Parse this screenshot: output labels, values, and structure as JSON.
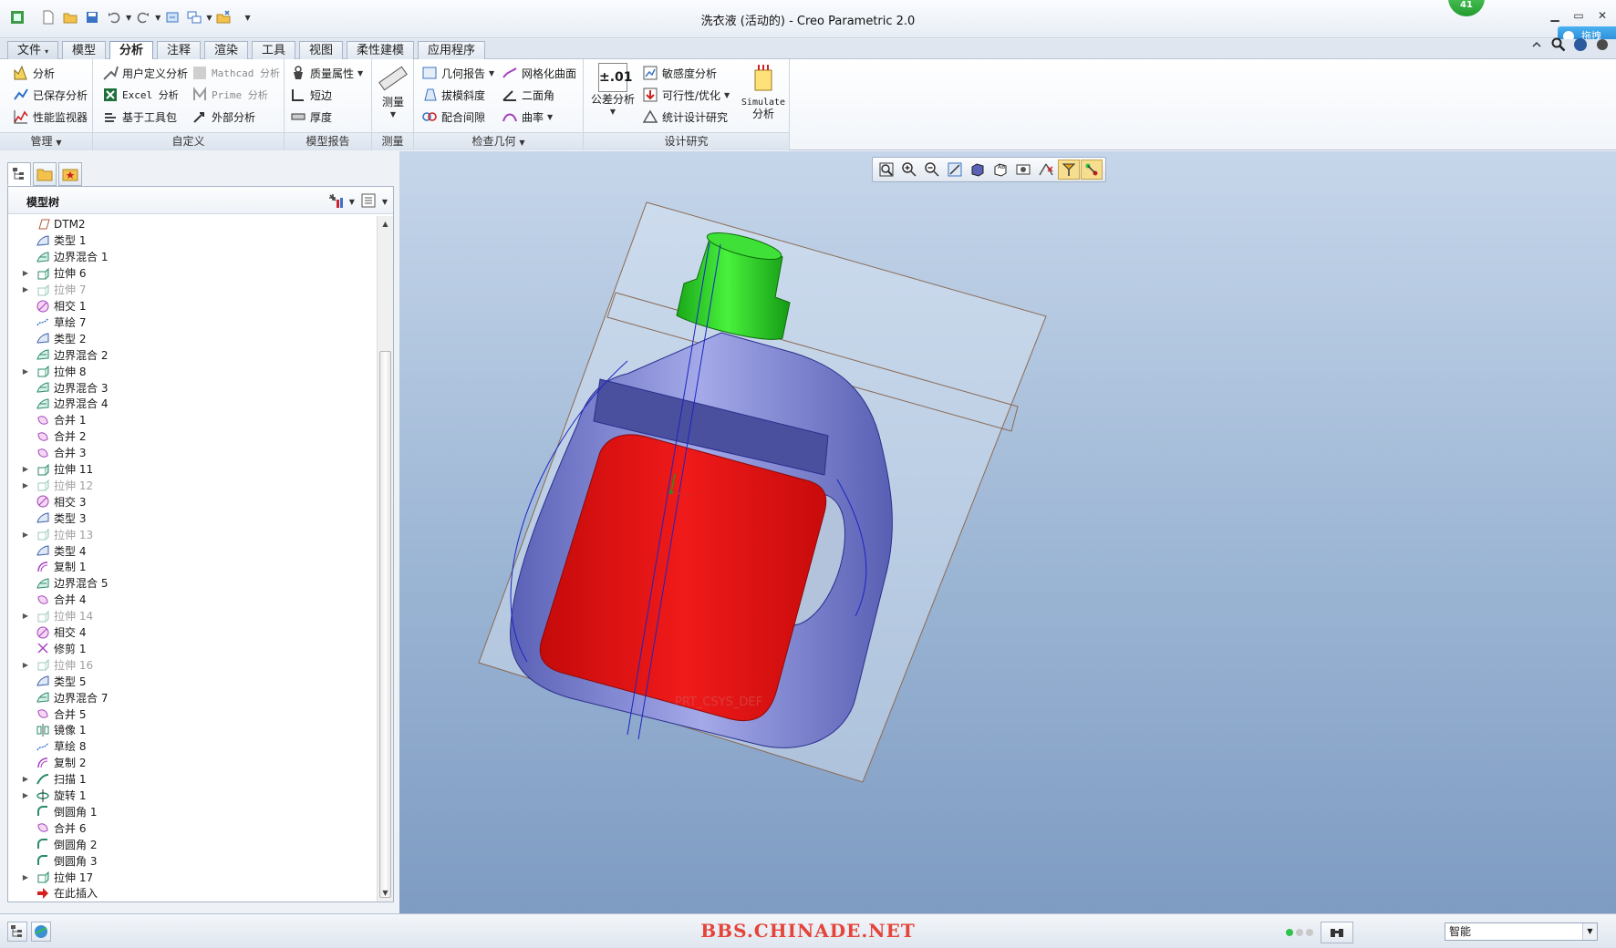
{
  "window": {
    "title": "洗衣液 (活动的) - Creo Parametric 2.0",
    "badge": "41",
    "yunpan_label": "拖拽"
  },
  "tabs": [
    {
      "label": "文件",
      "dropdown": "▾"
    },
    {
      "label": "模型"
    },
    {
      "label": "分析"
    },
    {
      "label": "注释"
    },
    {
      "label": "渲染"
    },
    {
      "label": "工具"
    },
    {
      "label": "视图"
    },
    {
      "label": "柔性建模"
    },
    {
      "label": "应用程序"
    }
  ],
  "ribbon": {
    "manage": {
      "label": "管理",
      "items": [
        "分析",
        "已保存分析",
        "性能监视器"
      ]
    },
    "custom": {
      "label": "自定义",
      "items": [
        "用户定义分析",
        "Excel 分析",
        "基于工具包",
        "Mathcad 分析",
        "Prime 分析",
        "外部分析"
      ]
    },
    "model_report": {
      "label": "模型报告",
      "items": [
        "质量属性",
        "短边",
        "厚度"
      ]
    },
    "measure": {
      "label": "测量",
      "button": "测量"
    },
    "inspect": {
      "label": "检查几何",
      "items": [
        "几何报告",
        "拔模斜度",
        "配合间隙",
        "网格化曲面",
        "二面角",
        "曲率"
      ]
    },
    "design": {
      "label": "设计研究",
      "tolerance": "公差分析",
      "tolerance_icon": "±.01",
      "items": [
        "敏感度分析",
        "可行性/优化",
        "统计设计研究"
      ],
      "simulate_line1": "Simulate",
      "simulate_line2": "分析"
    }
  },
  "tree": {
    "header": "模型树",
    "items": [
      {
        "label": "DTM2",
        "icon": "plane",
        "exp": "",
        "sup": false
      },
      {
        "label": "类型 1",
        "icon": "surface",
        "exp": "",
        "sup": false
      },
      {
        "label": "边界混合 1",
        "icon": "blend",
        "exp": "",
        "sup": false
      },
      {
        "label": "拉伸 6",
        "icon": "extrude",
        "exp": "▶",
        "sup": false
      },
      {
        "label": "拉伸 7",
        "icon": "extrude",
        "exp": "▶",
        "sup": true
      },
      {
        "label": "相交 1",
        "icon": "intersect",
        "exp": "",
        "sup": false
      },
      {
        "label": "草绘 7",
        "icon": "sketch",
        "exp": "",
        "sup": false
      },
      {
        "label": "类型 2",
        "icon": "surface",
        "exp": "",
        "sup": false
      },
      {
        "label": "边界混合 2",
        "icon": "blend",
        "exp": "",
        "sup": false
      },
      {
        "label": "拉伸 8",
        "icon": "extrude",
        "exp": "▶",
        "sup": false
      },
      {
        "label": "边界混合 3",
        "icon": "blend",
        "exp": "",
        "sup": false
      },
      {
        "label": "边界混合 4",
        "icon": "blend",
        "exp": "",
        "sup": false
      },
      {
        "label": "合并 1",
        "icon": "merge",
        "exp": "",
        "sup": false
      },
      {
        "label": "合并 2",
        "icon": "merge",
        "exp": "",
        "sup": false
      },
      {
        "label": "合并 3",
        "icon": "merge",
        "exp": "",
        "sup": false
      },
      {
        "label": "拉伸 11",
        "icon": "extrude",
        "exp": "▶",
        "sup": false
      },
      {
        "label": "拉伸 12",
        "icon": "extrude",
        "exp": "▶",
        "sup": true
      },
      {
        "label": "相交 3",
        "icon": "intersect",
        "exp": "",
        "sup": false
      },
      {
        "label": "类型 3",
        "icon": "surface",
        "exp": "",
        "sup": false
      },
      {
        "label": "拉伸 13",
        "icon": "extrude",
        "exp": "▶",
        "sup": true
      },
      {
        "label": "类型 4",
        "icon": "surface",
        "exp": "",
        "sup": false
      },
      {
        "label": "复制 1",
        "icon": "copy",
        "exp": "",
        "sup": false
      },
      {
        "label": "边界混合 5",
        "icon": "blend",
        "exp": "",
        "sup": false
      },
      {
        "label": "合并 4",
        "icon": "merge",
        "exp": "",
        "sup": false
      },
      {
        "label": "拉伸 14",
        "icon": "extrude",
        "exp": "▶",
        "sup": true
      },
      {
        "label": "相交 4",
        "icon": "intersect",
        "exp": "",
        "sup": false
      },
      {
        "label": "修剪 1",
        "icon": "trim",
        "exp": "",
        "sup": false
      },
      {
        "label": "拉伸 16",
        "icon": "extrude",
        "exp": "▶",
        "sup": true
      },
      {
        "label": "类型 5",
        "icon": "surface",
        "exp": "",
        "sup": false
      },
      {
        "label": "边界混合 7",
        "icon": "blend",
        "exp": "",
        "sup": false
      },
      {
        "label": "合并 5",
        "icon": "merge",
        "exp": "",
        "sup": false
      },
      {
        "label": "镜像 1",
        "icon": "mirror",
        "exp": "",
        "sup": false
      },
      {
        "label": "草绘 8",
        "icon": "sketch",
        "exp": "",
        "sup": false
      },
      {
        "label": "复制 2",
        "icon": "copy",
        "exp": "",
        "sup": false
      },
      {
        "label": "扫描 1",
        "icon": "sweep",
        "exp": "▶",
        "sup": false
      },
      {
        "label": "旋转 1",
        "icon": "revolve",
        "exp": "▶",
        "sup": false
      },
      {
        "label": "倒圆角 1",
        "icon": "round",
        "exp": "",
        "sup": false
      },
      {
        "label": "合并 6",
        "icon": "merge",
        "exp": "",
        "sup": false
      },
      {
        "label": "倒圆角 2",
        "icon": "round",
        "exp": "",
        "sup": false
      },
      {
        "label": "倒圆角 3",
        "icon": "round",
        "exp": "",
        "sup": false
      },
      {
        "label": "拉伸 17",
        "icon": "extrude",
        "exp": "▶",
        "sup": false
      },
      {
        "label": "在此插入",
        "icon": "insert",
        "exp": "",
        "sup": false
      }
    ]
  },
  "viewport": {
    "csys_label": "PRT_CSYS_DEF"
  },
  "status": {
    "watermark": "BBS.CHINADE.NET",
    "filter": "智能"
  },
  "colors": {
    "accent": "#2f6fb7",
    "bottle": "#7f86d1",
    "cap": "#22d81f",
    "label": "#e60d0d",
    "viewport_top": "#c6d6ea",
    "viewport_bottom": "#7e9bc2"
  }
}
